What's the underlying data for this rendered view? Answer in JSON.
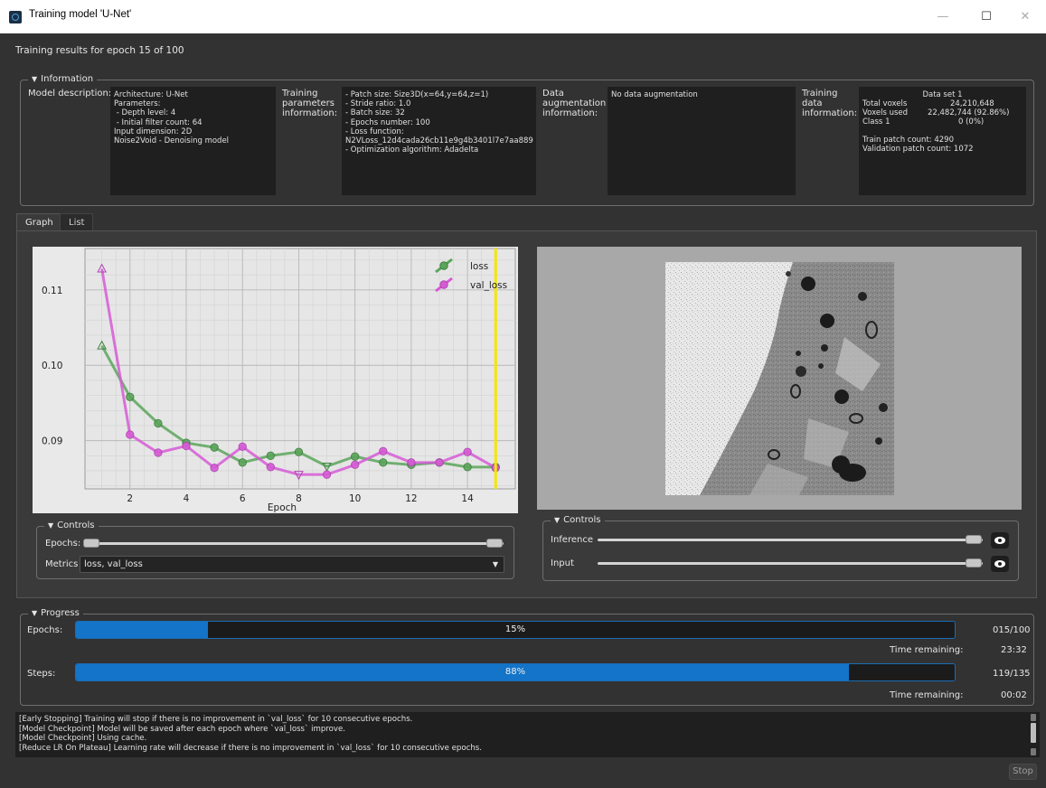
{
  "window": {
    "title": "Training model 'U-Net'"
  },
  "epoch_title": "Training results for epoch 15 of 100",
  "information": {
    "header": "Information",
    "model_description_label": "Model description:",
    "model_description": "Architecture: U-Net\nParameters:\n - Depth level: 4\n - Initial filter count: 64\nInput dimension: 2D\nNoise2Void - Denoising model",
    "training_params_label": "Training\nparameters\ninformation:",
    "training_params": "- Patch size: Size3D(x=64,y=64,z=1)\n- Stride ratio: 1.0\n- Batch size: 32\n- Epochs number: 100\n- Loss function:\nN2VLoss_12d4cada26cb11e9g4b3401l7e7aa889\n- Optimization algorithm: Adadelta",
    "augmentation_label": "Data\naugmentation\ninformation:",
    "augmentation": "No data augmentation",
    "training_data_label": "Training\ndata\ninformation:",
    "training_data": {
      "dataset": "Data set 1",
      "total_voxels_label": "Total voxels",
      "total_voxels": "24,210,648",
      "voxels_used_label": "Voxels used",
      "voxels_used": "22,482,744 (92.86%)",
      "class_label": "Class 1",
      "class_value": "0 (0%)",
      "train_patch": "Train patch count: 4290",
      "validation_patch": "Validation patch count: 1072"
    }
  },
  "tabs": [
    "Graph",
    "List"
  ],
  "chart_data": {
    "type": "line",
    "xlabel": "Epoch",
    "ylabel": "",
    "x": [
      1,
      2,
      3,
      4,
      5,
      6,
      7,
      8,
      9,
      10,
      11,
      12,
      13,
      14,
      15
    ],
    "series": [
      {
        "name": "loss",
        "color": "#5aa55a",
        "values": [
          0.1026,
          0.0958,
          0.0923,
          0.0897,
          0.0891,
          0.0871,
          0.088,
          0.0885,
          0.0866,
          0.0879,
          0.0871,
          0.0868,
          0.0871,
          0.0865,
          0.0865
        ]
      },
      {
        "name": "val_loss",
        "color": "#d65ad6",
        "values": [
          0.1128,
          0.0908,
          0.0884,
          0.0893,
          0.0864,
          0.0892,
          0.0865,
          0.0855,
          0.0855,
          0.0868,
          0.0886,
          0.0871,
          0.0871,
          0.0885,
          0.0864
        ]
      }
    ],
    "xticks": [
      2,
      4,
      6,
      8,
      10,
      12,
      14
    ],
    "yticks": [
      0.09,
      0.1,
      0.11
    ],
    "ytick_labels": [
      "0.09",
      "0.10",
      "0.11"
    ],
    "xlim": [
      0.4,
      15.7
    ],
    "ylim": [
      0.0836,
      0.1155
    ],
    "current_epoch": 15,
    "current_epoch_color": "#f2e600",
    "legend_position": "top-right",
    "grid": true
  },
  "graph_controls": {
    "header": "Controls",
    "epochs_label": "Epochs:",
    "metrics_label": "Metrics",
    "metrics_value": "loss, val_loss"
  },
  "image_controls": {
    "header": "Controls",
    "inference_label": "Inference",
    "input_label": "Input"
  },
  "progress": {
    "header": "Progress",
    "epochs_label": "Epochs:",
    "epochs_percent": "15%",
    "epochs_fraction": 0.15,
    "epochs_count": "015/100",
    "time_remaining_label": "Time remaining:",
    "epochs_time": "23:32",
    "steps_label": "Steps:",
    "steps_percent": "88%",
    "steps_fraction": 0.88,
    "steps_count": "119/135",
    "steps_time": "00:02"
  },
  "log_lines": [
    "[Early Stopping] Training will stop if there is no improvement in `val_loss` for 10 consecutive epochs.",
    "[Model Checkpoint] Model will be saved after each epoch where `val_loss` improve.",
    "[Model Checkpoint] Using cache.",
    "[Reduce LR On Plateau] Learning rate will decrease if there is no improvement in `val_loss` for 10 consecutive epochs."
  ],
  "stop_label": "Stop"
}
